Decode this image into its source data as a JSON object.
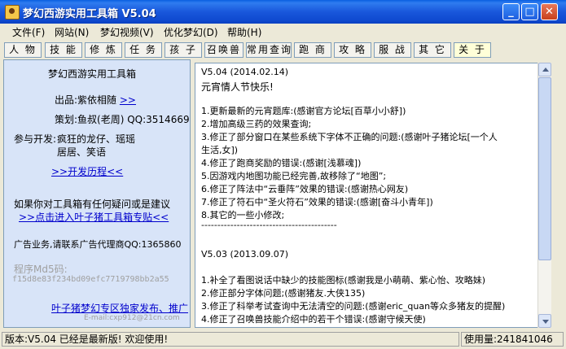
{
  "window": {
    "title": "梦幻西游实用工具箱 V5.04"
  },
  "menu": [
    {
      "label": "文件(F)"
    },
    {
      "label": "网站(N)"
    },
    {
      "label": "梦幻视频(V)"
    },
    {
      "label": "优化梦幻(D)"
    },
    {
      "label": "帮助(H)"
    }
  ],
  "tabs": [
    {
      "label": "人 物",
      "active": false
    },
    {
      "label": "技 能",
      "active": false
    },
    {
      "label": "修 炼",
      "active": false
    },
    {
      "label": "任 务",
      "active": false
    },
    {
      "label": "孩 子",
      "active": false
    },
    {
      "label": "召唤兽",
      "active": false
    },
    {
      "label": "常用查询",
      "active": false
    },
    {
      "label": "跑 商",
      "active": false
    },
    {
      "label": "攻 略",
      "active": false
    },
    {
      "label": "服 战",
      "active": false
    },
    {
      "label": "其 它",
      "active": false
    },
    {
      "label": "关 于",
      "active": true
    }
  ],
  "about": {
    "app_name": "梦幻西游实用工具箱",
    "producer_label": "出品:紫依相随",
    "producer_link": ">>",
    "planner": "策划:鱼叔(老周) QQ:3514669",
    "dev_label": "参与开发:",
    "dev_names_1": "疯狂的龙仔、瑶瑶",
    "dev_names_2": "居居、笑语",
    "history_link": ">>开发历程<<",
    "question_text": "如果你对工具箱有任何疑问或是建议",
    "forum_link": ">>点击进入叶子猪工具箱专贴<<",
    "ad_text": "广告业务,请联系广告代理商QQ:1365860",
    "md5_label": "程序Md5码:",
    "md5_value": "f15d8e83f234bd09efc7719798bb2a55",
    "exclusive_link": "叶子猪梦幻专区独家发布、推广",
    "email": "E-mail:cxp912@21cn.com"
  },
  "changelog": [
    "V5.04   (2014.02.14)",
    "元宵情人节快乐!",
    "",
    "1.更新最新的元宵题库:(感谢官方论坛[百草小小舒])",
    "2.增加高级三药的效果查询;",
    "3.修正了部分窗口在某些系统下字体不正确的问题:(感谢叶子猪论坛[一个人",
    "生活,女])",
    "4.修正了跑商奖励的错误:(感谢[浅慕魂])",
    "5.因游戏内地图功能已经完善,故移除了“地图”;",
    "6.修正了阵法中“云垂阵”效果的错误:(感谢热心网友)",
    "7.修正了符石中“圣火符石”效果的错误:(感谢[奋斗小青年])",
    "8.其它的一些小修改;",
    "------------------------------------------",
    "",
    "",
    "V5.03   (2013.09.07)",
    "",
    "1.补全了看图说话中缺少的技能图标(感谢我是小萌萌、紫心怡、攻略妹)",
    "2.修正部分字体问题;(感谢猪友.大侠135)",
    "3.修正了科举考试查询中无法清空的问题:(感谢eric_quan等众多猪友的提醒)",
    "4.修正了召唤兽技能介绍中的若干个错误:(感谢守候天使)"
  ],
  "status": {
    "version": "版本:V5.04 已经是最新版! 欢迎使用!",
    "usage": "使用量:241841046"
  },
  "colors": {
    "link": "#0000CC",
    "titlebar": "#1957DB",
    "left_panel_bg": "#D8E4F8"
  }
}
